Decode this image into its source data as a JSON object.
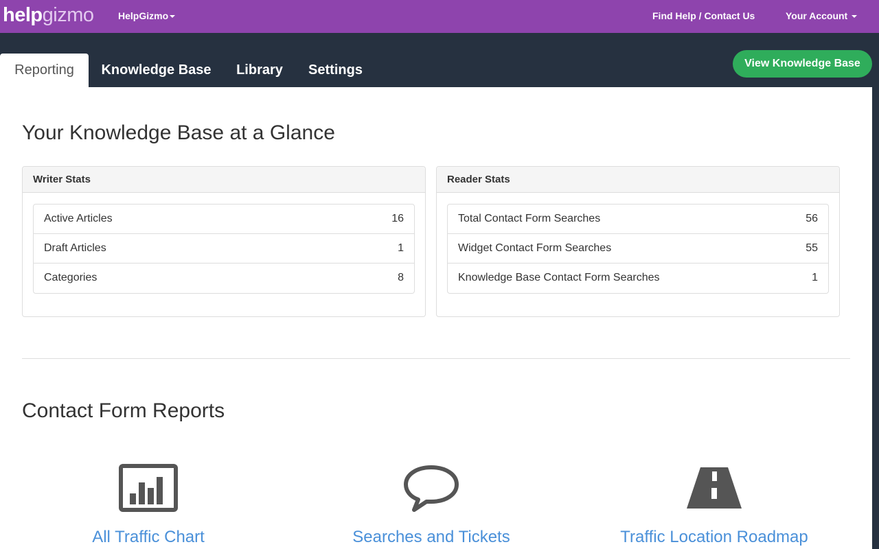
{
  "header": {
    "logo_bold": "help",
    "logo_light": "gizmo",
    "org_menu": "HelpGizmo",
    "find_help": "Find Help / Contact Us",
    "account": "Your Account"
  },
  "tabs": [
    {
      "label": "Reporting",
      "active": true
    },
    {
      "label": "Knowledge Base",
      "active": false
    },
    {
      "label": "Library",
      "active": false
    },
    {
      "label": "Settings",
      "active": false
    }
  ],
  "view_kb_button": "View Knowledge Base",
  "glance": {
    "title": "Your Knowledge Base at a Glance",
    "writer": {
      "title": "Writer Stats",
      "rows": [
        {
          "name": "Active Articles",
          "value": "16"
        },
        {
          "name": "Draft Articles",
          "value": "1"
        },
        {
          "name": "Categories",
          "value": "8"
        }
      ]
    },
    "reader": {
      "title": "Reader Stats",
      "rows": [
        {
          "name": "Total Contact Form Searches",
          "value": "56"
        },
        {
          "name": "Widget Contact Form Searches",
          "value": "55"
        },
        {
          "name": "Knowledge Base Contact Form Searches",
          "value": "1"
        }
      ]
    }
  },
  "reports": {
    "title": "Contact Form Reports",
    "items": [
      {
        "label": "All Traffic Chart",
        "icon": "bar-chart-icon"
      },
      {
        "label": "Searches and Tickets",
        "icon": "speech-bubble-icon"
      },
      {
        "label": "Traffic Location Roadmap",
        "icon": "road-icon"
      }
    ]
  },
  "colors": {
    "topbar": "#8e44ad",
    "navbar": "#263140",
    "accent_green": "#2fad5b",
    "link_blue": "#4a90d9"
  }
}
